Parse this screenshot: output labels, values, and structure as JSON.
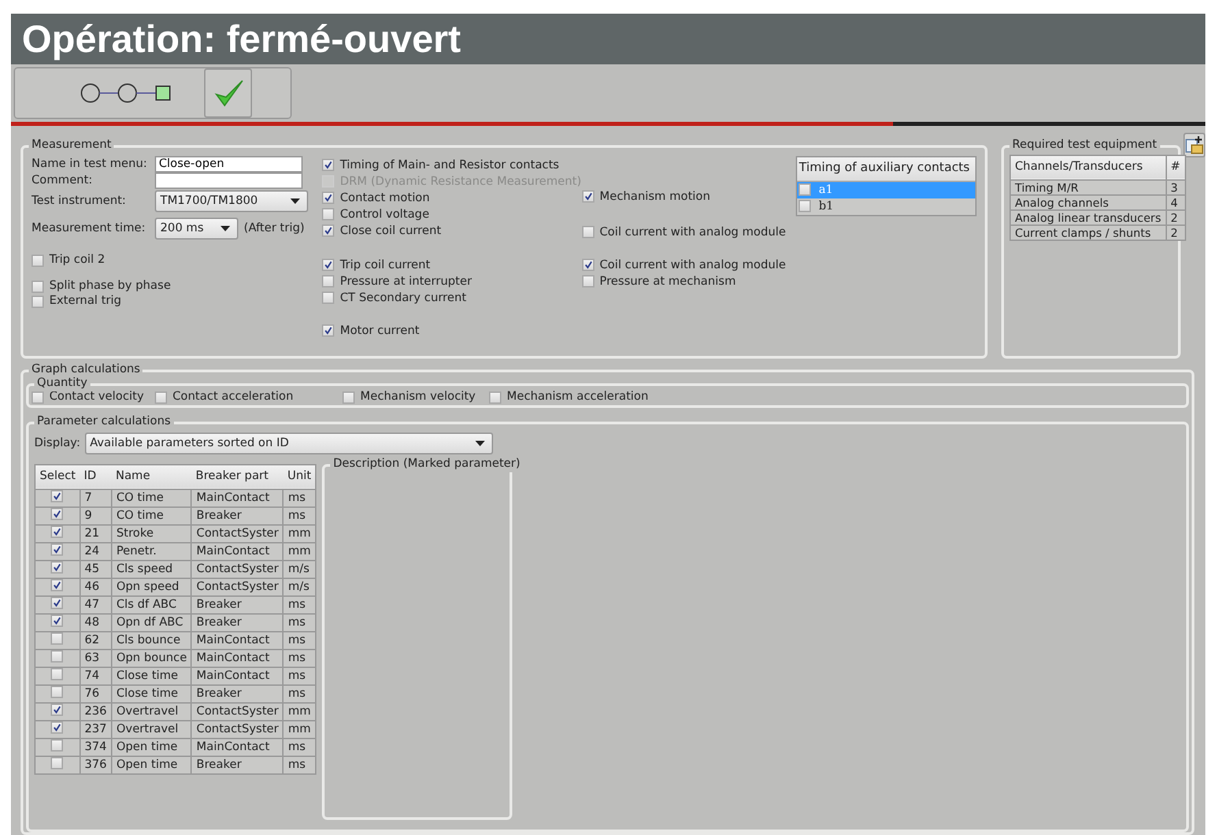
{
  "window": {
    "title": "Opération: fermé-ouvert"
  },
  "measurement": {
    "legend": "Measurement",
    "fields": [
      {
        "label": "Name in test menu:",
        "kind": "text",
        "value": "Close-open"
      },
      {
        "label": "Comment:",
        "kind": "text"
      },
      {
        "label": "Test instrument:",
        "kind": "select",
        "value": "TM1700/TM1800"
      },
      {
        "label": "Measurement time:",
        "kind": "small-select",
        "value": "200 ms",
        "suffix": "(After trig)"
      }
    ],
    "left_options": [
      {
        "label": "Trip coil 2",
        "checked": false
      },
      {
        "label": "Split phase by phase",
        "checked": false
      },
      {
        "label": "External trig",
        "checked": false
      }
    ],
    "middle_groups": [
      [
        {
          "label": "Timing of Main- and Resistor contacts",
          "checked": true,
          "disabled": false
        },
        {
          "label": "DRM (Dynamic Resistance Measurement)",
          "checked": false,
          "disabled": true
        },
        {
          "label": "Contact motion",
          "checked": true,
          "disabled": false
        },
        {
          "label": "Control voltage",
          "checked": false,
          "disabled": false
        },
        {
          "label": "Close coil current",
          "checked": true,
          "disabled": false
        }
      ],
      [
        {
          "label": "Trip coil current",
          "checked": true,
          "disabled": false
        },
        {
          "label": "Pressure at interrupter",
          "checked": false,
          "disabled": false
        },
        {
          "label": "CT Secondary current",
          "checked": false,
          "disabled": false
        }
      ],
      [
        {
          "label": "Motor current",
          "checked": true,
          "disabled": false
        }
      ]
    ],
    "right_groups": [
      [
        {
          "label": "Mechanism motion",
          "checked": true
        },
        {
          "label": "Coil current with analog module",
          "checked": false
        }
      ],
      [
        {
          "label": "Coil current with analog module",
          "checked": true
        },
        {
          "label": "Pressure at mechanism",
          "checked": false
        }
      ]
    ],
    "aux_contacts": {
      "header": "Timing of auxiliary contacts",
      "items": [
        {
          "label": "a1",
          "checked": false,
          "selected": true
        },
        {
          "label": "b1",
          "checked": false,
          "selected": false
        }
      ]
    }
  },
  "equipment": {
    "legend": "Required test equipment",
    "columns": [
      "Channels/Transducers",
      "#"
    ],
    "rows": [
      [
        "Timing M/R",
        "3"
      ],
      [
        "Analog channels",
        "4"
      ],
      [
        "Analog linear transducers",
        "2"
      ],
      [
        "Current clamps / shunts",
        "2"
      ]
    ]
  },
  "graph": {
    "legend": "Graph calculations",
    "quantity": {
      "legend": "Quantity",
      "items": [
        {
          "label": "Contact velocity",
          "checked": false
        },
        {
          "label": "Contact acceleration",
          "checked": false
        },
        {
          "label": "Mechanism velocity",
          "checked": false
        },
        {
          "label": "Mechanism acceleration",
          "checked": false
        }
      ]
    },
    "parameters": {
      "legend": "Parameter calculations",
      "display_label": "Display:",
      "display_value": "Available parameters sorted on ID",
      "columns": [
        "Select",
        "ID",
        "Name",
        "Breaker part",
        "Unit"
      ],
      "rows": [
        {
          "checked": true,
          "id": "7",
          "name": "CO time",
          "part": "MainContact",
          "unit": "ms"
        },
        {
          "checked": true,
          "id": "9",
          "name": "CO time",
          "part": "Breaker",
          "unit": "ms"
        },
        {
          "checked": true,
          "id": "21",
          "name": "Stroke",
          "part": "ContactSyster",
          "unit": "mm"
        },
        {
          "checked": true,
          "id": "24",
          "name": "Penetr.",
          "part": "MainContact",
          "unit": "mm"
        },
        {
          "checked": true,
          "id": "45",
          "name": "Cls speed",
          "part": "ContactSyster",
          "unit": "m/s"
        },
        {
          "checked": true,
          "id": "46",
          "name": "Opn speed",
          "part": "ContactSyster",
          "unit": "m/s"
        },
        {
          "checked": true,
          "id": "47",
          "name": "Cls df ABC",
          "part": "Breaker",
          "unit": "ms"
        },
        {
          "checked": true,
          "id": "48",
          "name": "Opn df ABC",
          "part": "Breaker",
          "unit": "ms"
        },
        {
          "checked": false,
          "id": "62",
          "name": "Cls bounce",
          "part": "MainContact",
          "unit": "ms"
        },
        {
          "checked": false,
          "id": "63",
          "name": "Opn bounce",
          "part": "MainContact",
          "unit": "ms"
        },
        {
          "checked": false,
          "id": "74",
          "name": "Close time",
          "part": "MainContact",
          "unit": "ms"
        },
        {
          "checked": false,
          "id": "76",
          "name": "Close time",
          "part": "Breaker",
          "unit": "ms"
        },
        {
          "checked": true,
          "id": "236",
          "name": "Overtravel",
          "part": "ContactSyster",
          "unit": "mm"
        },
        {
          "checked": true,
          "id": "237",
          "name": "Overtravel",
          "part": "ContactSyster",
          "unit": "mm"
        },
        {
          "checked": false,
          "id": "374",
          "name": "Open time",
          "part": "MainContact",
          "unit": "ms"
        },
        {
          "checked": false,
          "id": "376",
          "name": "Open time",
          "part": "Breaker",
          "unit": "ms"
        }
      ],
      "description_legend": "Description (Marked parameter)"
    }
  }
}
